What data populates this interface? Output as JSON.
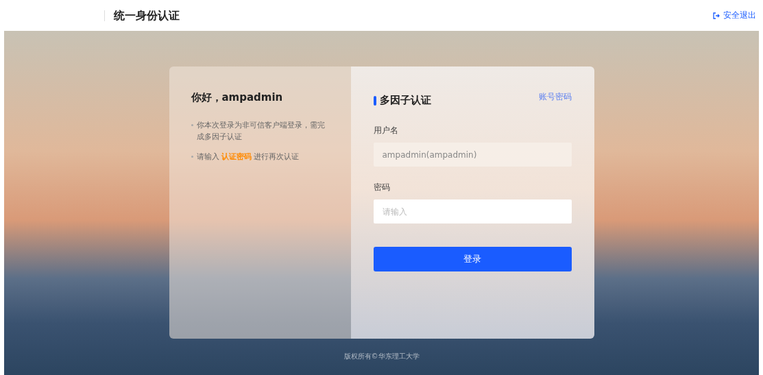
{
  "header": {
    "title": "统一身份认证",
    "logout": "安全退出"
  },
  "greeting": "你好，ampadmin",
  "notes": [
    [
      {
        "text": "你本次登录为非可信客户端登录，需完成多因子认证",
        "highlight": false
      }
    ],
    [
      {
        "text": "请输入 ",
        "highlight": false
      },
      {
        "text": "认证密码",
        "highlight": true
      },
      {
        "text": " 进行再次认证",
        "highlight": false
      }
    ]
  ],
  "form": {
    "title": "多因子认证",
    "switch_link": "账号密码",
    "fields": [
      {
        "label": "用户名",
        "value": "ampadmin(ampadmin)",
        "disabled": true
      },
      {
        "label": "密码",
        "placeholder": "请输入",
        "disabled": false
      }
    ],
    "submit": "登录"
  },
  "footer": "版权所有©华东理工大学"
}
